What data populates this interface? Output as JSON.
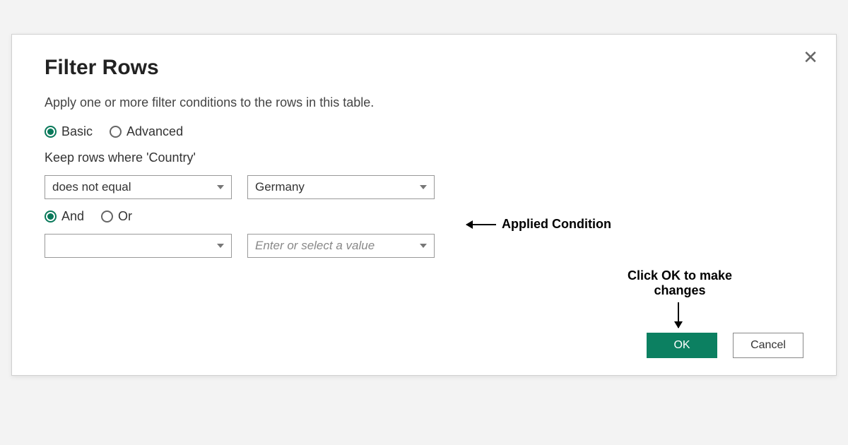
{
  "dialog": {
    "title": "Filter Rows",
    "subtitle": "Apply one or more filter conditions to the rows in this table.",
    "close_label": "✕",
    "mode": {
      "basic_label": "Basic",
      "advanced_label": "Advanced",
      "selected": "basic"
    },
    "keep_label": "Keep rows where 'Country'",
    "condition1": {
      "operator": "does not equal",
      "value": "Germany"
    },
    "logic": {
      "and_label": "And",
      "or_label": "Or",
      "selected": "and"
    },
    "condition2": {
      "operator": "",
      "value_placeholder": "Enter or select a value"
    },
    "buttons": {
      "ok": "OK",
      "cancel": "Cancel"
    }
  },
  "annotations": {
    "applied_condition": "Applied Condition",
    "click_ok": "Click OK to make changes"
  }
}
